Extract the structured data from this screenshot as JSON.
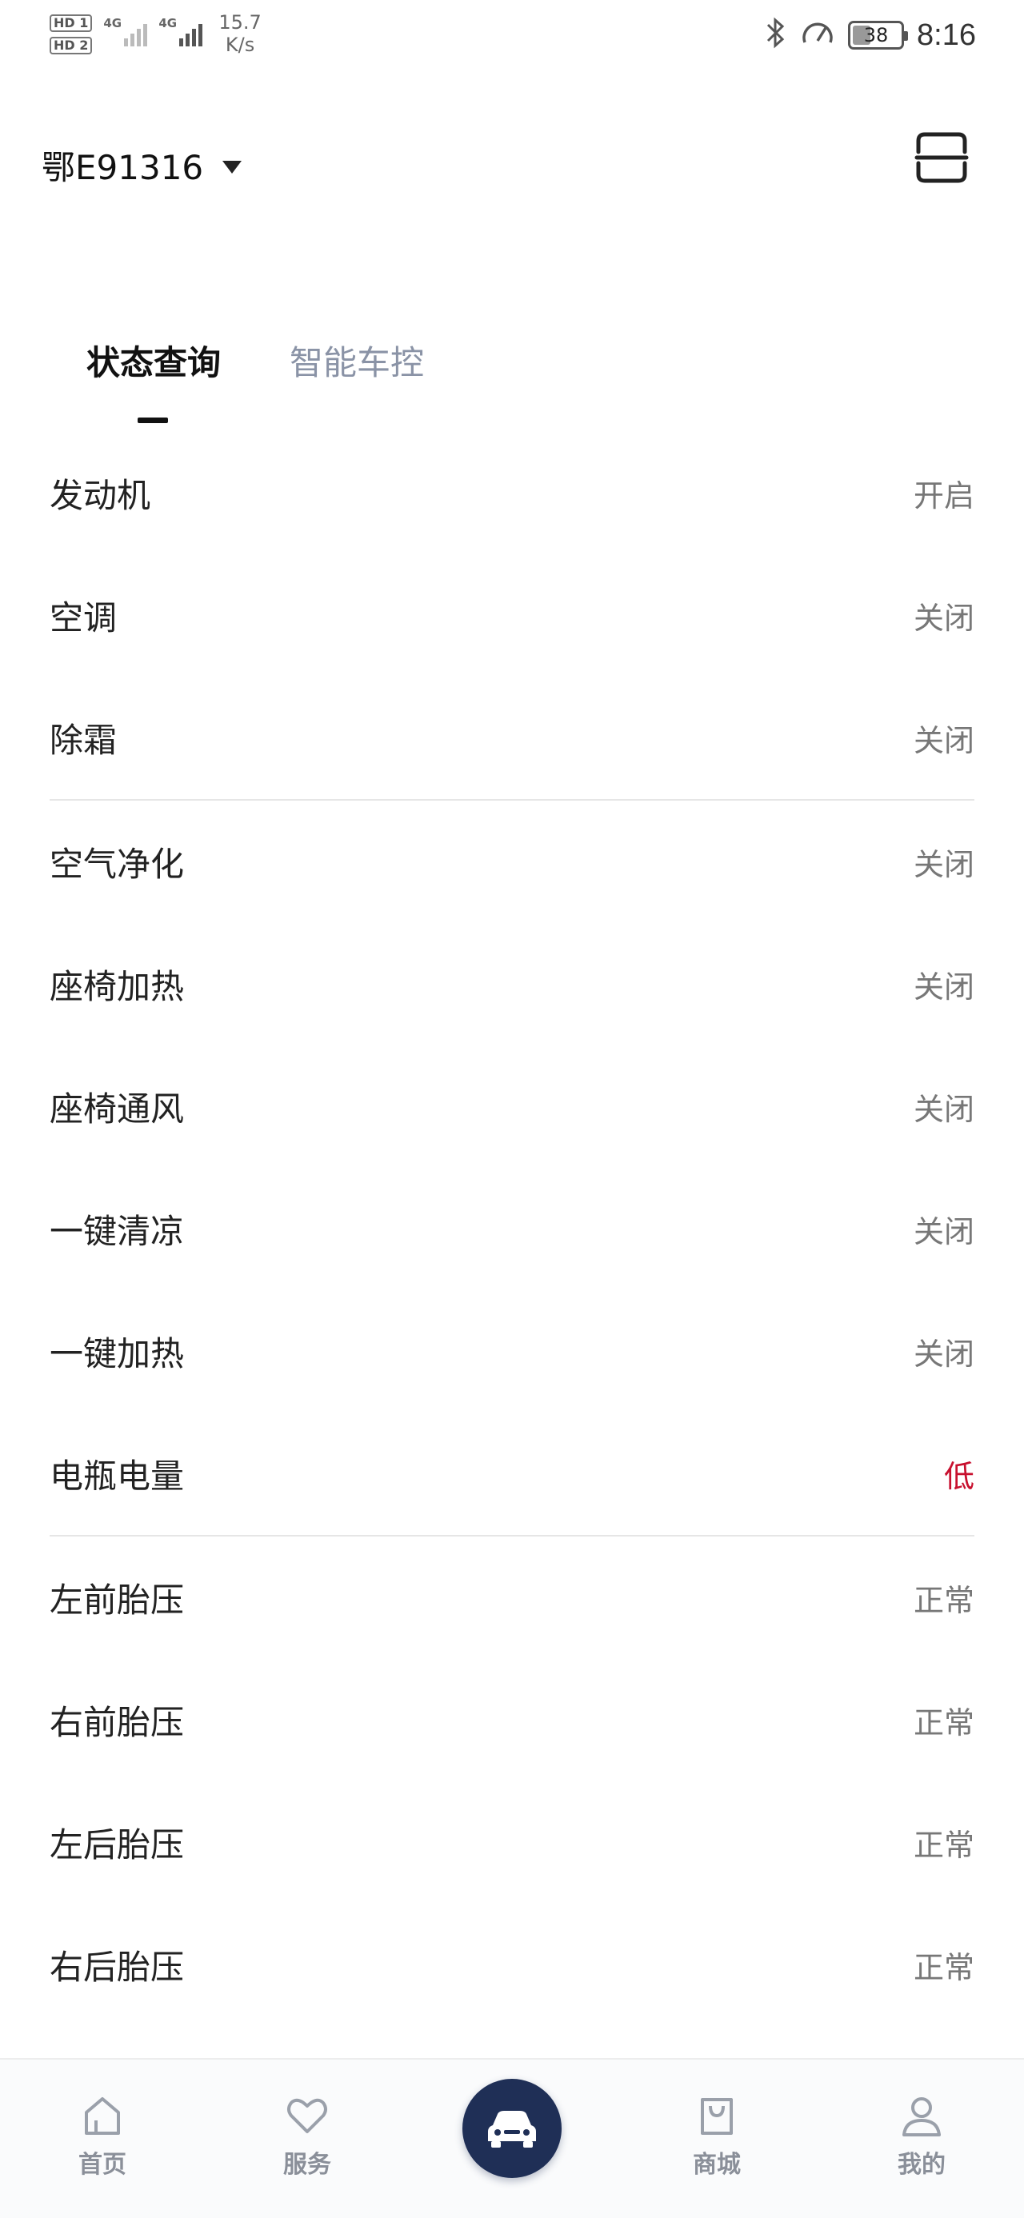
{
  "status_bar": {
    "hd1": "HD 1",
    "hd2": "HD 2",
    "net1": "4G",
    "net2": "4G",
    "speed_value": "15.7",
    "speed_unit": "K/s",
    "bluetooth_icon": "bluetooth-icon",
    "speedometer_icon": "speedometer-icon",
    "battery_level": "38",
    "battery_fraction": 0.38,
    "time": "8:16"
  },
  "header": {
    "plate": "鄂E91316",
    "dropdown_icon": "caret-down-icon",
    "scan_icon": "scan-icon"
  },
  "tabs": [
    {
      "label": "状态查询",
      "active": true
    },
    {
      "label": "智能车控",
      "active": false
    }
  ],
  "status_items": [
    {
      "name": "发动机",
      "value": "开启"
    },
    {
      "name": "空调",
      "value": "关闭"
    },
    {
      "name": "除霜",
      "value": "关闭"
    },
    {
      "name": "空气净化",
      "value": "关闭"
    },
    {
      "name": "座椅加热",
      "value": "关闭"
    },
    {
      "name": "座椅通风",
      "value": "关闭"
    },
    {
      "name": "一键清凉",
      "value": "关闭"
    },
    {
      "name": "一键加热",
      "value": "关闭"
    },
    {
      "name": "电瓶电量",
      "value": "低"
    },
    {
      "name": "左前胎压",
      "value": "正常"
    },
    {
      "name": "右前胎压",
      "value": "正常"
    },
    {
      "name": "左后胎压",
      "value": "正常"
    },
    {
      "name": "右后胎压",
      "value": "正常"
    }
  ],
  "colors": {
    "warning": "#c8102e",
    "accent_dark": "#1f2f56",
    "inactive_tab": "#8a93a6"
  },
  "bottom_nav": [
    {
      "label": "首页",
      "icon": "home-icon"
    },
    {
      "label": "服务",
      "icon": "heart-icon"
    },
    {
      "label": "",
      "icon": "car-icon"
    },
    {
      "label": "商城",
      "icon": "shopping-bag-icon"
    },
    {
      "label": "我的",
      "icon": "user-icon"
    }
  ]
}
